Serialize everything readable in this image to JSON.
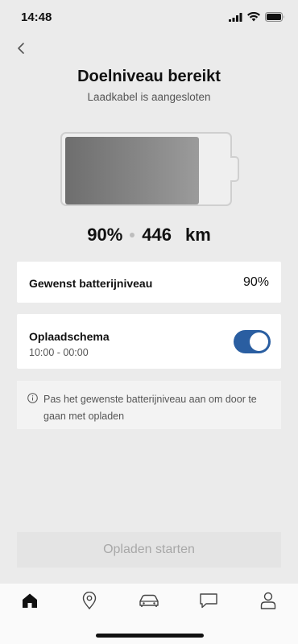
{
  "status_bar": {
    "time": "14:48",
    "icons": [
      "signal-icon",
      "wifi-icon",
      "battery-status-icon"
    ]
  },
  "header": {
    "back_icon": "chevron-left-icon",
    "title": "Doelniveau bereikt",
    "subtitle": "Laadkabel is aangesloten"
  },
  "battery": {
    "charge_percent": 90,
    "percent_label": "90%",
    "range_value": "446",
    "range_unit": "km",
    "fill_color": "#7a7a7a"
  },
  "target_card": {
    "label": "Gewenst batterijniveau",
    "value": "90%"
  },
  "schedule_card": {
    "label": "Oplaadschema",
    "time_range": "10:00 - 00:00",
    "toggle_on": true,
    "toggle_color": "#2a5ea1"
  },
  "info": {
    "icon": "info-icon",
    "text": "Pas het gewenste batterijniveau aan om door te gaan met opladen"
  },
  "start_button": {
    "label": "Opladen starten",
    "disabled": true
  },
  "tab_bar": {
    "tabs": [
      {
        "icon": "home-icon",
        "active": true
      },
      {
        "icon": "location-pin-icon",
        "active": false
      },
      {
        "icon": "car-icon",
        "active": false
      },
      {
        "icon": "chat-icon",
        "active": false
      },
      {
        "icon": "profile-icon",
        "active": false
      }
    ]
  }
}
